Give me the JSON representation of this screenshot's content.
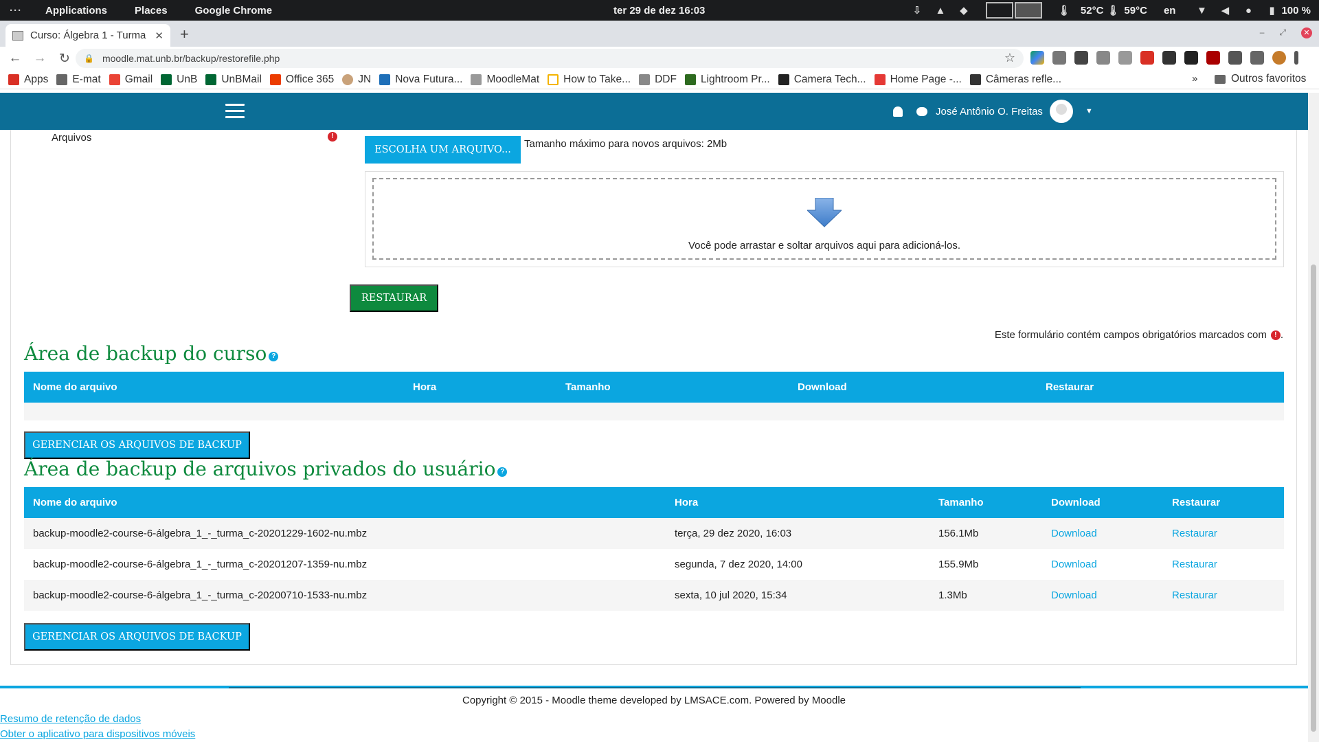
{
  "system_bar": {
    "dots": "···",
    "menus": [
      "Applications",
      "Places",
      "Google Chrome"
    ],
    "clock": "ter 29 de dez  16:03",
    "temp1": "52°C",
    "temp2": "59°C",
    "lang": "en",
    "battery": "100 %"
  },
  "browser": {
    "tab_title": "Curso: Álgebra 1 - Turma",
    "url": "moodle.mat.unb.br/backup/restorefile.php",
    "bookmarks": [
      {
        "label": "Apps",
        "color": "#d93025"
      },
      {
        "label": "E-mat",
        "color": "#666666"
      },
      {
        "label": "Gmail",
        "color": "#ea4335"
      },
      {
        "label": "UnB",
        "color": "#006633"
      },
      {
        "label": "UnBMail",
        "color": "#006633"
      },
      {
        "label": "Office 365",
        "color": "#eb3c00"
      },
      {
        "label": "JN",
        "color": "#c9a27a"
      },
      {
        "label": "Nova Futura...",
        "color": "#1e6fb8"
      },
      {
        "label": "MoodleMat",
        "color": "#999999"
      },
      {
        "label": "How to Take...",
        "color": "#f4b400"
      },
      {
        "label": "DDF",
        "color": "#888888"
      },
      {
        "label": "Lightroom Pr...",
        "color": "#2d6a1f"
      },
      {
        "label": "Camera Tech...",
        "color": "#222222"
      },
      {
        "label": "Home Page -...",
        "color": "#e53935"
      },
      {
        "label": "Câmeras refle...",
        "color": "#333333"
      }
    ],
    "more": "»",
    "other_bookmarks": "Outros favoritos"
  },
  "header": {
    "user_name": "José Antônio O. Freitas"
  },
  "upload": {
    "label": "Arquivos",
    "required_icon": "!",
    "choose_button": "ESCOLHA UM ARQUIVO...",
    "max_size": "Tamanho máximo para novos arquivos: 2Mb",
    "drop_text": "Você pode arrastar e soltar arquivos aqui para adicioná-los.",
    "restore_button": "RESTAURAR",
    "form_note": "Este formulário contém campos obrigatórios marcados com",
    "form_note_end": "."
  },
  "course_backup": {
    "title": "Área de backup do curso",
    "help": "?",
    "columns": [
      "Nome do arquivo",
      "Hora",
      "Tamanho",
      "Download",
      "Restaurar"
    ],
    "manage_button": "GERENCIAR OS ARQUIVOS DE BACKUP"
  },
  "user_backup": {
    "title": "Área de backup de arquivos privados do usuário",
    "help": "?",
    "columns": [
      "Nome do arquivo",
      "Hora",
      "Tamanho",
      "Download",
      "Restaurar"
    ],
    "rows": [
      {
        "name": "backup-moodle2-course-6-álgebra_1_-_turma_c-20201229-1602-nu.mbz",
        "time": "terça, 29 dez 2020, 16:03",
        "size": "156.1Mb",
        "download": "Download",
        "restore": "Restaurar"
      },
      {
        "name": "backup-moodle2-course-6-álgebra_1_-_turma_c-20201207-1359-nu.mbz",
        "time": "segunda, 7 dez 2020, 14:00",
        "size": "155.9Mb",
        "download": "Download",
        "restore": "Restaurar"
      },
      {
        "name": "backup-moodle2-course-6-álgebra_1_-_turma_c-20200710-1533-nu.mbz",
        "time": "sexta, 10 jul 2020, 15:34",
        "size": "1.3Mb",
        "download": "Download",
        "restore": "Restaurar"
      }
    ],
    "manage_button": "GERENCIAR OS ARQUIVOS DE BACKUP"
  },
  "footer": {
    "copyright": "Copyright © 2015 - Moodle theme developed by LMSACE.com. Powered by Moodle",
    "links": [
      "Resumo de retenção de dados",
      "Obter o aplicativo para dispositivos móveis"
    ]
  },
  "colors": {
    "header_bg": "#0c6e96",
    "accent_blue": "#0ba6e0",
    "accent_green": "#0e8a3e",
    "required_red": "#d7262c"
  }
}
